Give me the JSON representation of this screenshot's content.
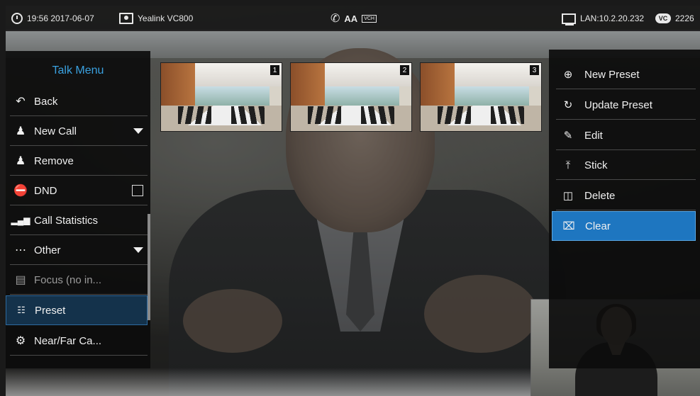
{
  "status_bar": {
    "time_date": "19:56 2017-06-07",
    "device_name": "Yealink VC800",
    "font_label": "AA",
    "vch_label": "VCH",
    "lan_label": "LAN:10.2.20.232",
    "vc_label": "VC",
    "vc_number": "2226"
  },
  "talk_menu": {
    "title": "Talk Menu",
    "items": [
      {
        "label": "Back",
        "icon": "back-arrow-icon"
      },
      {
        "label": "New Call",
        "icon": "add-person-icon"
      },
      {
        "label": "Remove",
        "icon": "remove-person-icon"
      },
      {
        "label": "DND",
        "icon": "dnd-icon",
        "checked": false
      },
      {
        "label": "Call Statistics",
        "icon": "signal-bars-icon"
      },
      {
        "label": "Other",
        "icon": "more-circle-icon"
      },
      {
        "label": "Focus (no in...",
        "icon": "monitor-icon",
        "disabled": true
      },
      {
        "label": "Preset",
        "icon": "preset-icon",
        "selected": true
      },
      {
        "label": "Near/Far Ca...",
        "icon": "camera-settings-icon"
      }
    ]
  },
  "presets": [
    {
      "number": "1"
    },
    {
      "number": "2"
    },
    {
      "number": "3"
    }
  ],
  "preset_menu": {
    "items": [
      {
        "label": "New Preset",
        "icon": "plus-circle-icon"
      },
      {
        "label": "Update Preset",
        "icon": "refresh-icon"
      },
      {
        "label": "Edit",
        "icon": "pencil-icon"
      },
      {
        "label": "Stick",
        "icon": "pin-top-icon"
      },
      {
        "label": "Delete",
        "icon": "trash-icon"
      },
      {
        "label": "Clear",
        "icon": "clear-icon",
        "selected": true
      }
    ]
  },
  "colors": {
    "accent": "#1e76c0",
    "menu_title": "#3aa1e0",
    "selected_bg": "#14324b"
  }
}
